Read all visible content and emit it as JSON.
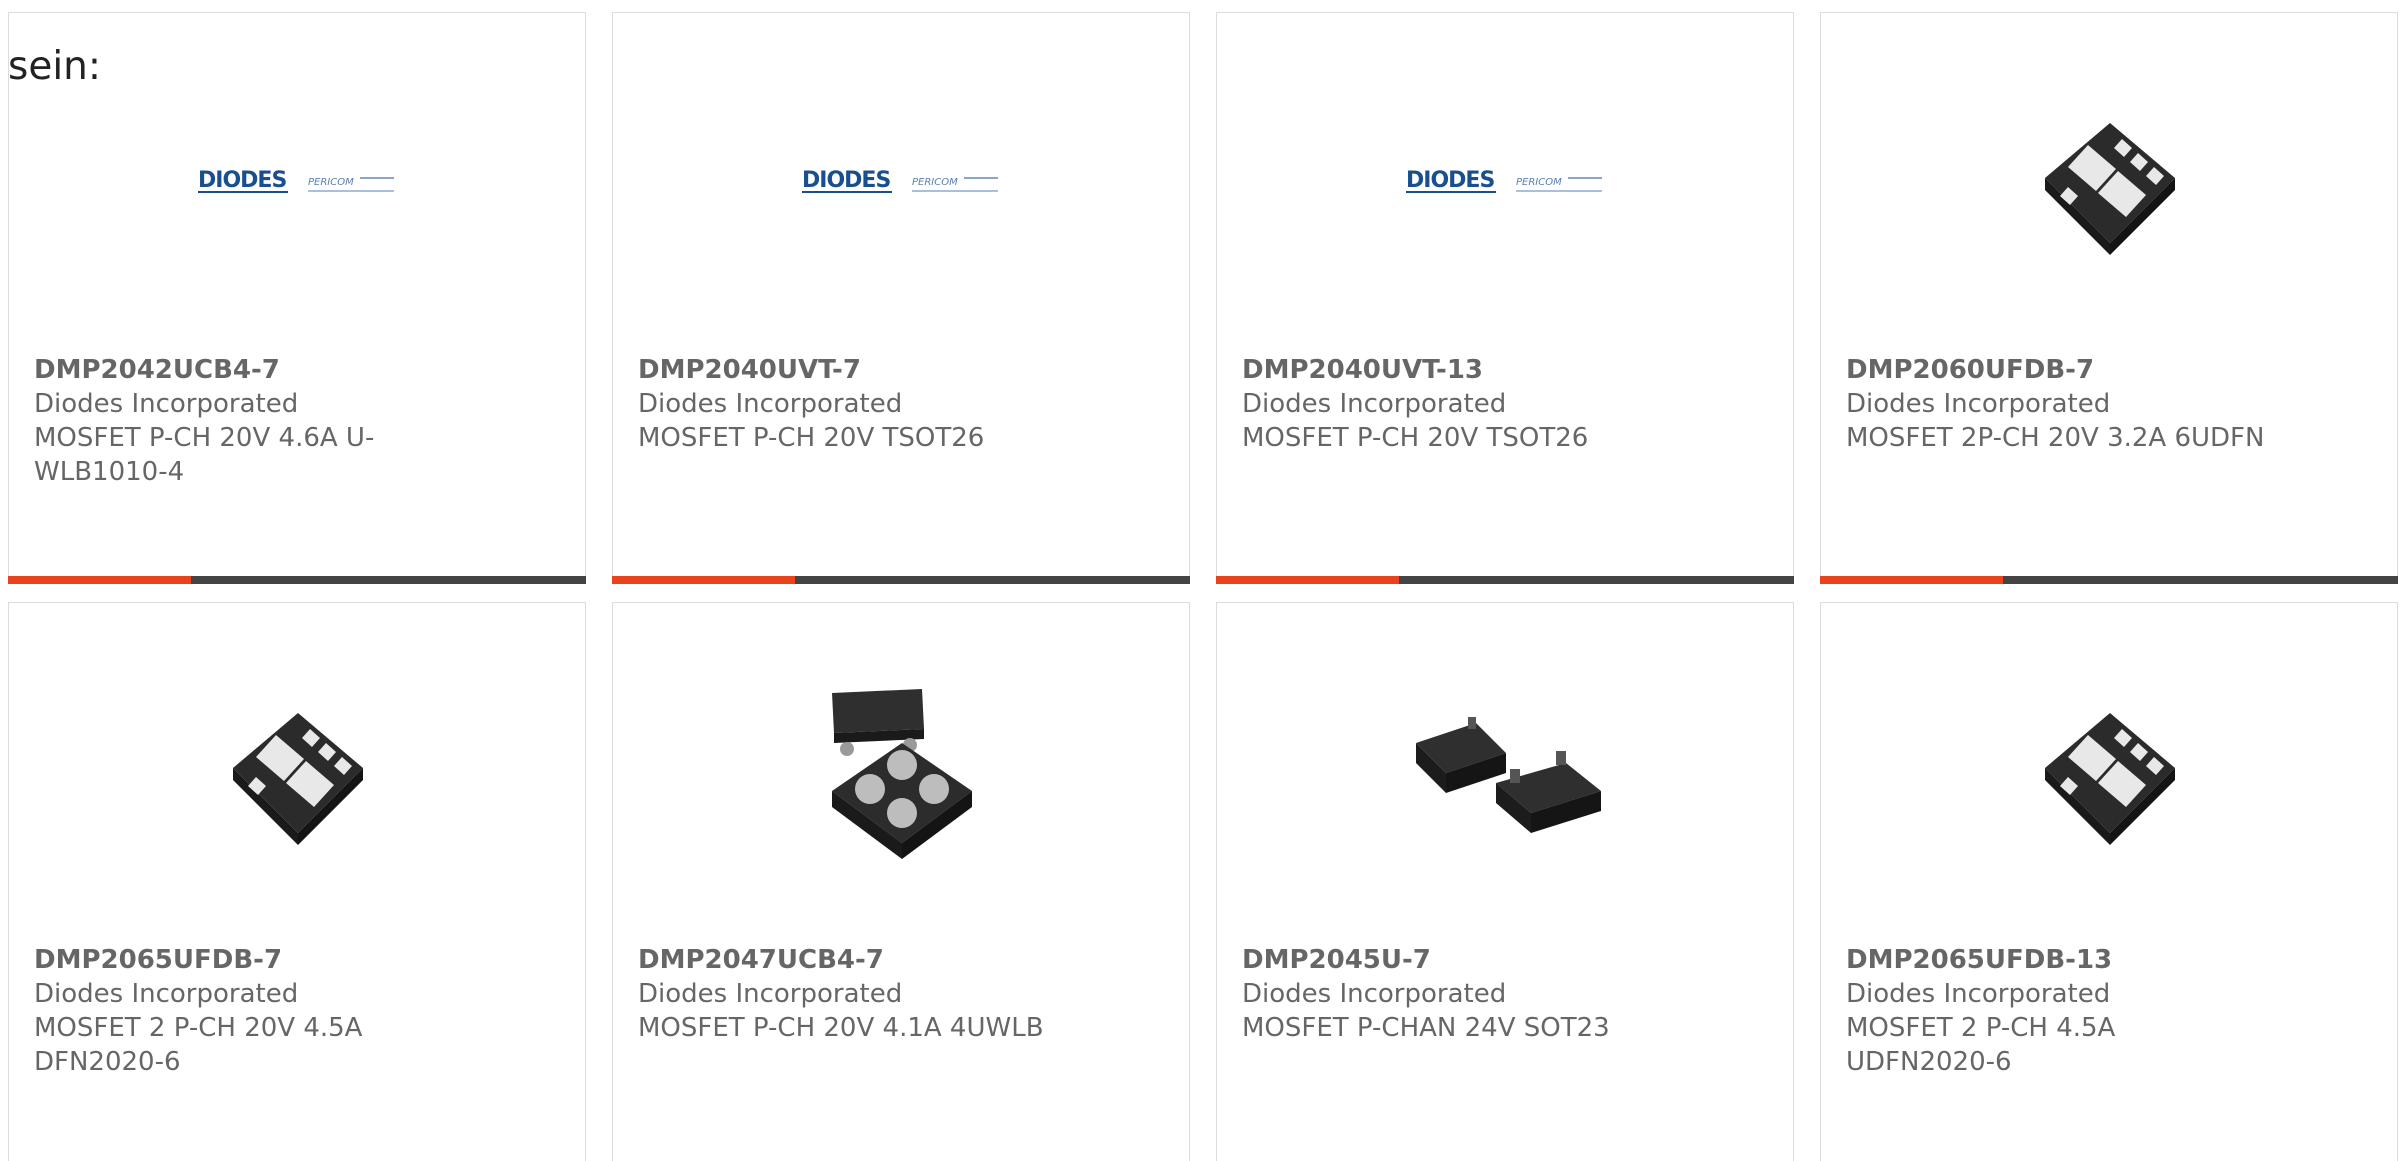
{
  "intro_text": "sein:",
  "colors": {
    "accent": "#e8431c",
    "bar": "#444444",
    "card_border": "#dcdcdc",
    "text": "#666666",
    "logo_blue": "#1a4f8f"
  },
  "products": [
    {
      "part_number": "DMP2042UCB4-7",
      "manufacturer": "Diodes Incorporated",
      "description": "MOSFET P-CH 20V 4.6A U-WLB1010-4",
      "image": "diodes-pericom-logo"
    },
    {
      "part_number": "DMP2040UVT-7",
      "manufacturer": "Diodes Incorporated",
      "description": "MOSFET P-CH 20V TSOT26",
      "image": "diodes-pericom-logo"
    },
    {
      "part_number": "DMP2040UVT-13",
      "manufacturer": "Diodes Incorporated",
      "description": "MOSFET P-CH 20V TSOT26",
      "image": "diodes-pericom-logo"
    },
    {
      "part_number": "DMP2060UFDB-7",
      "manufacturer": "Diodes Incorporated",
      "description": "MOSFET 2P-CH 20V 3.2A 6UDFN",
      "image": "udfn-6-package"
    },
    {
      "part_number": "DMP2065UFDB-7",
      "manufacturer": "Diodes Incorporated",
      "description": "MOSFET 2 P-CH 20V 4.5A DFN2020-6",
      "image": "udfn-6-package"
    },
    {
      "part_number": "DMP2047UCB4-7",
      "manufacturer": "Diodes Incorporated",
      "description": "MOSFET P-CH 20V 4.1A 4UWLB",
      "image": "wlb-4-package"
    },
    {
      "part_number": "DMP2045U-7",
      "manufacturer": "Diodes Incorporated",
      "description": "MOSFET P-CHAN 24V SOT23",
      "image": "sot23-package"
    },
    {
      "part_number": "DMP2065UFDB-13",
      "manufacturer": "Diodes Incorporated",
      "description": "MOSFET 2 P-CH 4.5A UDFN2020-6",
      "image": "udfn-6-package"
    }
  ]
}
